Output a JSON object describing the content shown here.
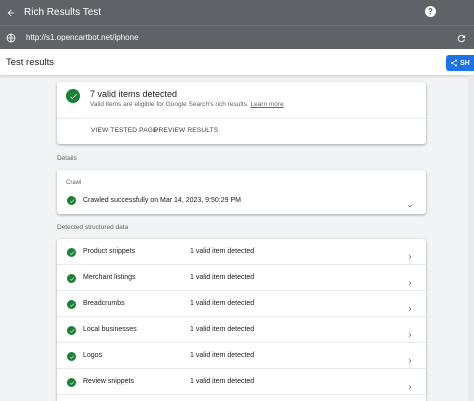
{
  "app": {
    "title": "Rich Results Test"
  },
  "url": {
    "value": "http://s1.opencartbot.net/iphone"
  },
  "header": {
    "title": "Test results",
    "share_label": "SH"
  },
  "summary": {
    "title": "7 valid items detected",
    "subtitle": "Valid items are eligible for Google Search's rich results.",
    "learn_more": "Learn more",
    "actions": [
      "VIEW TESTED PAGE",
      "PREVIEW RESULTS"
    ]
  },
  "details": {
    "label": "Details",
    "crawl_label": "Crawl",
    "crawl_text": "Crawled successfully on Mar 14, 2023, 9:50:29 PM"
  },
  "structured": {
    "label": "Detected structured data",
    "items": [
      {
        "name": "Product snippets",
        "status": "1 valid item detected"
      },
      {
        "name": "Merchant listings",
        "status": "1 valid item detected"
      },
      {
        "name": "Breadcrumbs",
        "status": "1 valid item detected"
      },
      {
        "name": "Local businesses",
        "status": "1 valid item detected"
      },
      {
        "name": "Logos",
        "status": "1 valid item detected"
      },
      {
        "name": "Review snippets",
        "status": "1 valid item detected"
      }
    ]
  },
  "colors": {
    "topbar": "#5f6368",
    "success": "#188038",
    "accent": "#1a73e8"
  }
}
